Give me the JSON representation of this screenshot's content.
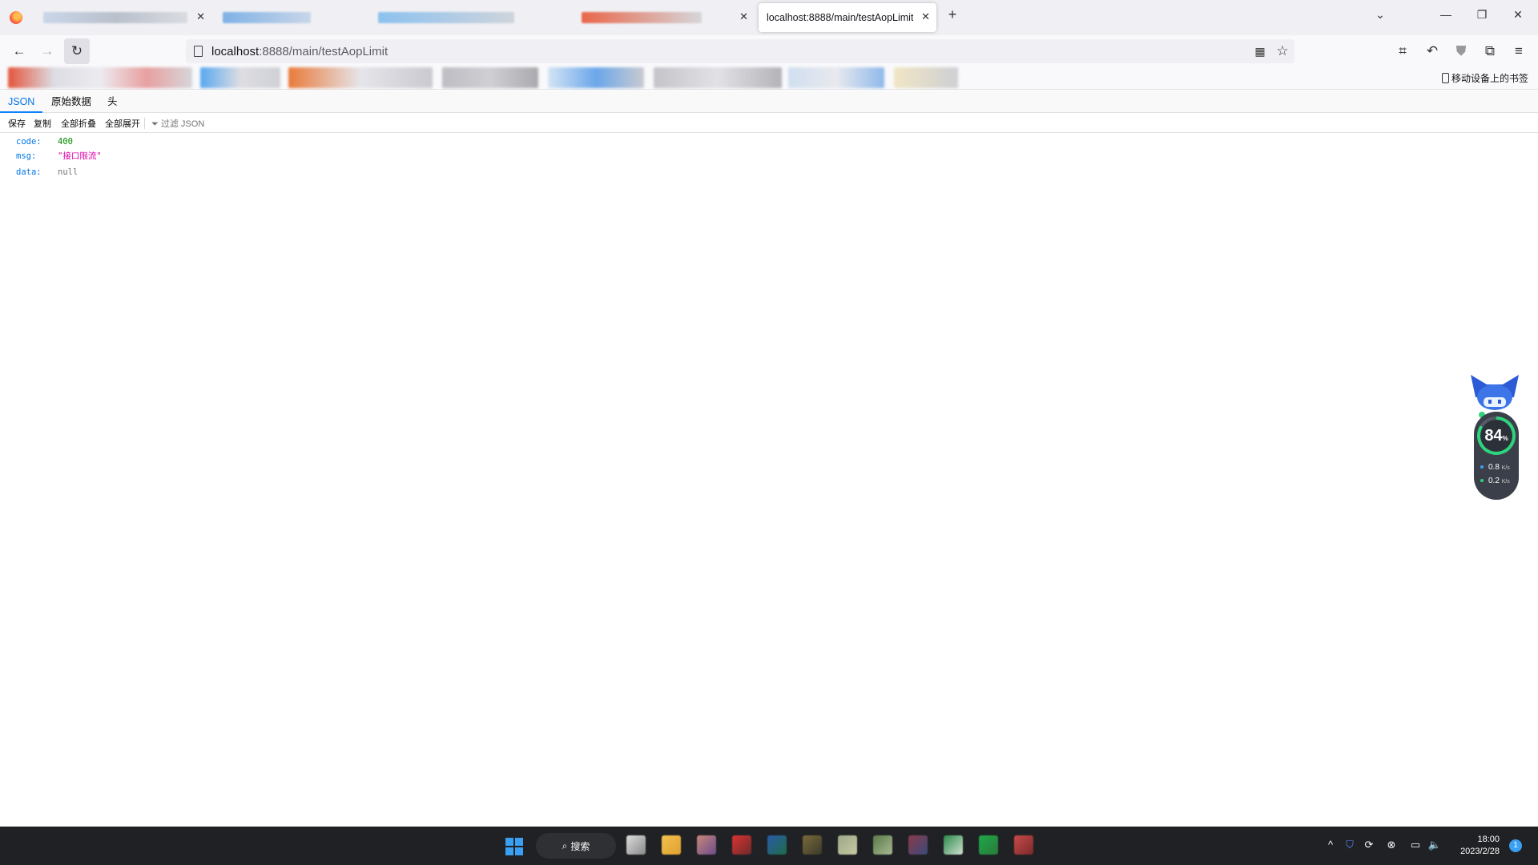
{
  "browser": {
    "tabs": [
      {
        "title": "",
        "blurred": true
      },
      {
        "title": "",
        "blurred": true
      },
      {
        "title": "",
        "blurred": true
      },
      {
        "title": "",
        "blurred": true
      },
      {
        "title": "localhost:8888/main/testAopLimit",
        "active": true
      }
    ],
    "new_tab_label": "+",
    "address": {
      "host": "localhost",
      "rest": ":8888/main/testAopLimit"
    },
    "bookmarks_mobile_label": "移动设备上的书签"
  },
  "viewer": {
    "tabs": [
      "JSON",
      "原始数据",
      "头"
    ],
    "toolbar": {
      "save": "保存",
      "copy": "复制",
      "collapse_all": "全部折叠",
      "expand_all": "全部展开",
      "filter_placeholder": "过滤 JSON"
    },
    "json": {
      "rows": [
        {
          "key": "code:",
          "value": "400",
          "type": "number"
        },
        {
          "key": "msg:",
          "value": "\"接口限流\"",
          "type": "string"
        },
        {
          "key": "data:",
          "value": "null",
          "type": "null"
        }
      ]
    }
  },
  "widget": {
    "percent": "84",
    "percent_unit": "%",
    "up_speed": "0.8",
    "down_speed": "0.2",
    "unit": "K/s"
  },
  "taskbar": {
    "search_label": "搜索",
    "time": "18:00",
    "date": "2023/2/28",
    "notification_count": "1"
  },
  "colors": {
    "accent": "#0a84ff",
    "json_key": "#0074e8",
    "json_string": "#dd00a9",
    "json_number": "#058b00",
    "taskbar": "#202124"
  }
}
